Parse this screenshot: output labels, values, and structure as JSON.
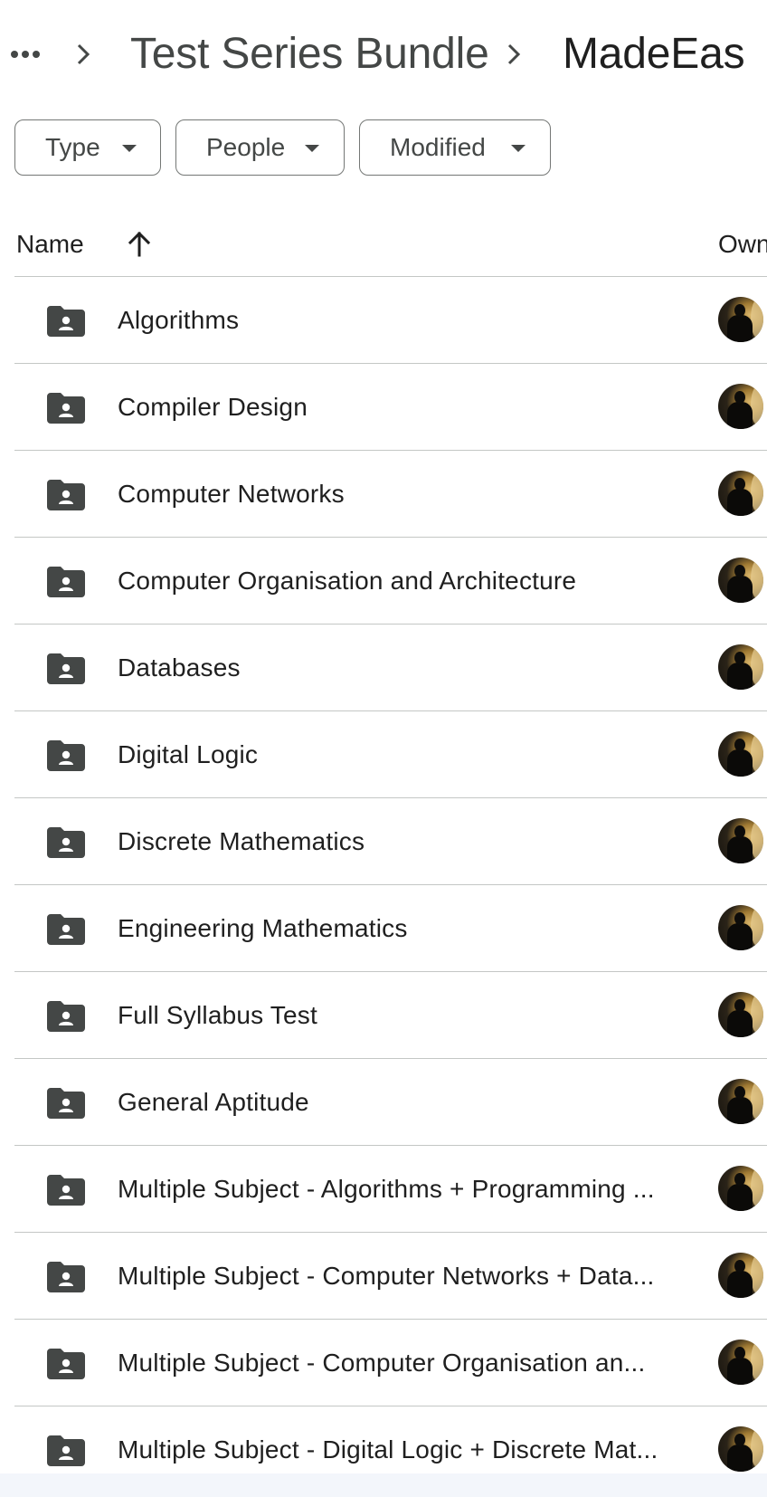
{
  "breadcrumb": {
    "more_icon": "more-horiz-icon",
    "items": [
      {
        "label": "Test Series Bundle"
      },
      {
        "label": "MadeEas"
      }
    ]
  },
  "filters": {
    "chips": [
      {
        "label": "Type"
      },
      {
        "label": "People"
      },
      {
        "label": "Modified"
      }
    ]
  },
  "table": {
    "columns": {
      "name": "Name",
      "owner": "Own"
    },
    "sort_icon": "arrow-upward-icon",
    "rows": [
      {
        "name": "Algorithms"
      },
      {
        "name": "Compiler Design"
      },
      {
        "name": "Computer Networks"
      },
      {
        "name": "Computer Organisation and Architecture"
      },
      {
        "name": "Databases"
      },
      {
        "name": "Digital Logic"
      },
      {
        "name": "Discrete Mathematics"
      },
      {
        "name": "Engineering Mathematics"
      },
      {
        "name": "Full Syllabus Test"
      },
      {
        "name": "General Aptitude"
      },
      {
        "name": "Multiple Subject - Algorithms + Programming ..."
      },
      {
        "name": "Multiple Subject - Computer Networks + Data..."
      },
      {
        "name": "Multiple Subject - Computer Organisation an..."
      },
      {
        "name": "Multiple Subject - Digital Logic + Discrete Mat..."
      }
    ]
  },
  "colors": {
    "text_primary": "#1f1f1f",
    "text_secondary": "#444746",
    "divider": "#c4c7c5",
    "chip_border": "#747775",
    "folder_icon": "#444746"
  }
}
